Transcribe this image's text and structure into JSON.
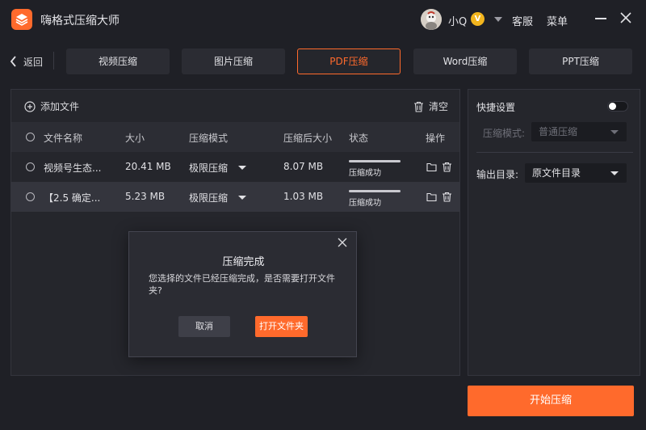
{
  "app": {
    "title": "嗨格式压缩大师",
    "accent": "#ff6a2c"
  },
  "user": {
    "name": "小Q",
    "badge": "V"
  },
  "header_links": {
    "service": "客服",
    "menu": "菜单"
  },
  "nav": {
    "back": "返回",
    "tabs": [
      {
        "label": "视频压缩",
        "active": false
      },
      {
        "label": "图片压缩",
        "active": false
      },
      {
        "label": "PDF压缩",
        "active": true
      },
      {
        "label": "Word压缩",
        "active": false
      },
      {
        "label": "PPT压缩",
        "active": false
      }
    ]
  },
  "toolbar": {
    "add_file": "添加文件",
    "clear": "清空"
  },
  "table": {
    "headers": [
      "文件名称",
      "大小",
      "压缩模式",
      "压缩后大小",
      "状态",
      "操作"
    ],
    "rows": [
      {
        "name": "视频号生态...",
        "size": "20.41 MB",
        "mode": "极限压缩",
        "compressed_size": "8.07 MB",
        "status": "压缩成功",
        "progress": 1.0
      },
      {
        "name": "【2.5 确定...",
        "size": "5.23 MB",
        "mode": "极限压缩",
        "compressed_size": "1.03 MB",
        "status": "压缩成功",
        "progress": 1.0
      }
    ]
  },
  "settings": {
    "quick_label": "快捷设置",
    "quick_enabled": false,
    "mode_label": "压缩模式:",
    "mode_value": "普通压缩",
    "output_label": "输出目录:",
    "output_value": "原文件目录"
  },
  "start_button": "开始压缩",
  "dialog": {
    "title": "压缩完成",
    "message": "您选择的文件已经压缩完成，是否需要打开文件夹?",
    "cancel": "取消",
    "open_folder": "打开文件夹"
  },
  "icons": {
    "logo": "layers-icon",
    "back": "chevron-left-icon",
    "add": "plus-circle-icon",
    "clear": "trash-icon",
    "folder": "folder-icon",
    "delete": "trash-icon",
    "close": "close-icon"
  }
}
